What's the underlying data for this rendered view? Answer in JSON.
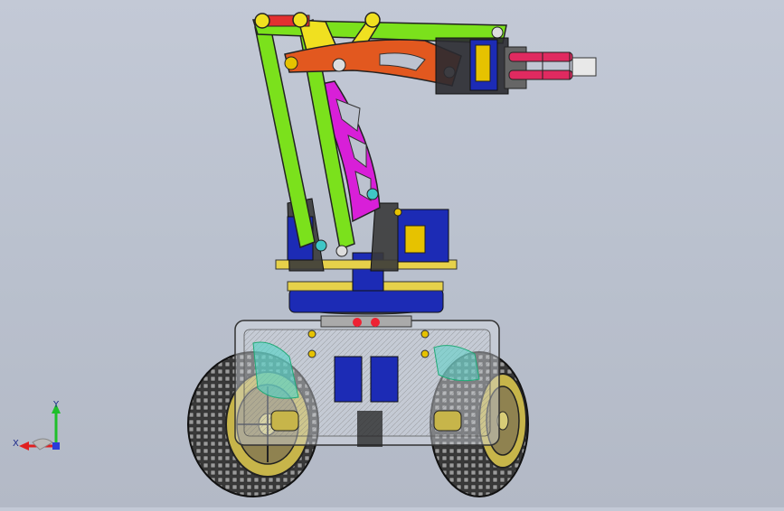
{
  "viewport": {
    "background_color": "#bcc2cf",
    "model": "robot-arm-on-wheeled-base"
  },
  "triad": {
    "y_label": "Y",
    "x_label": "X",
    "colors": {
      "y": "#1fbf2a",
      "x": "#e02020",
      "z": "#2a3cd8"
    }
  }
}
